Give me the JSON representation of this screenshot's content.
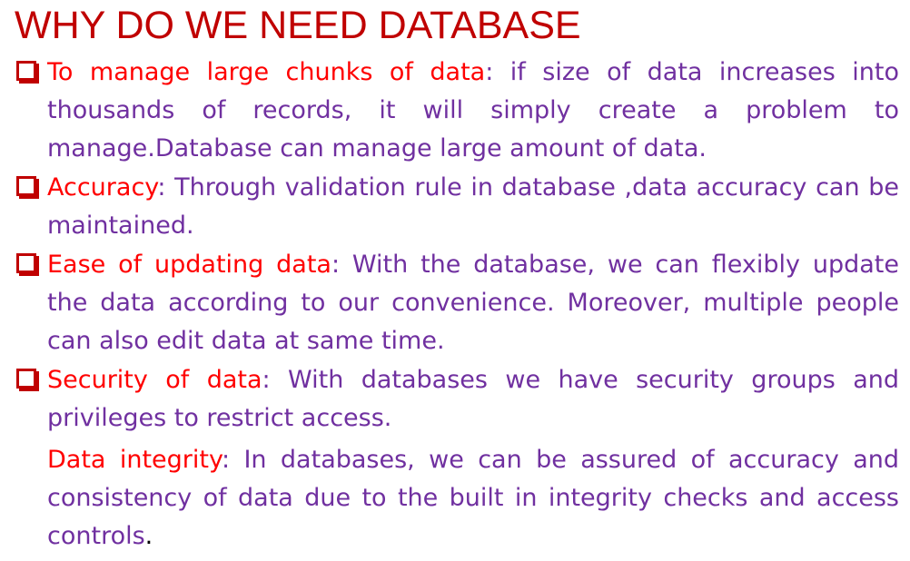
{
  "title": "WHY DO WE NEED DATABASE",
  "items": [
    {
      "term": "To manage large chunks of data",
      "text": ": if size of data increases into thousands of records, it will simply create a problem to manage.Database can manage large amount of data."
    },
    {
      "term": "Accuracy",
      "text": ": Through validation rule in database ,data accuracy can be maintained."
    },
    {
      "term": "Ease of updating data",
      "text": ": With the database, we can flexibly update the data according to our convenience. Moreover, multiple people can also edit data at same time."
    },
    {
      "term": "Security of data",
      "text": ": With databases we have security groups and privileges to restrict access."
    },
    {
      "term": "Data integrity",
      "text": ": In databases, we can be assured of accuracy and consistency of data due to the built in integrity checks and access controls",
      "end": "."
    }
  ]
}
